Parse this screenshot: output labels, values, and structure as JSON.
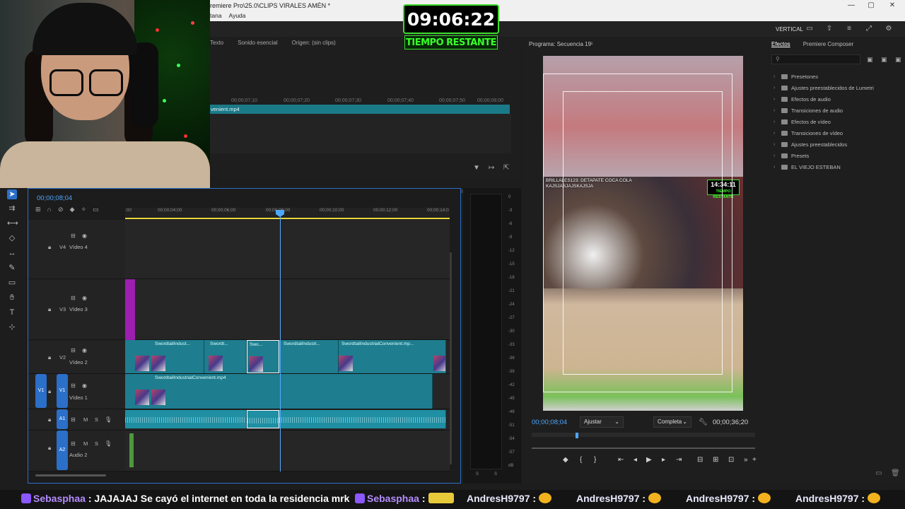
{
  "window": {
    "title": "remiere Pro\\25.0\\CLIPS VIRALES AMÉN *",
    "menu": [
      "tana",
      "Ayuda"
    ],
    "controls": [
      "—",
      "▢",
      "✕"
    ]
  },
  "workspace": {
    "label": "VERTICAL"
  },
  "overlay_timer": {
    "time": "09:06:22",
    "label": "TIEMPO RESTANTE"
  },
  "source_monitor": {
    "tabs": [
      "Texto",
      "Sonido esencial",
      "Origen: (sin clips)"
    ],
    "ruler": [
      "00;00;07;10",
      "00;00;07;20",
      "00;00;07;30",
      "00;00;07;40",
      "00;00;07;50",
      "00;00;08;00"
    ],
    "clip_name": "venient.mp4"
  },
  "program_monitor": {
    "title": "Programa: Secuencia 19",
    "timecode": "00;00;08;04",
    "duration": "00;00;36;20",
    "fit": "Ajustar",
    "quality": "Completa",
    "chat_overlay": "BRILLALES123: DETAPATE COCA COLA\nKAJSJASJAJSKAJSJA",
    "stream_timer": "14:34:11",
    "stream_timer_label": "TIEMPO RESTANTE"
  },
  "effects_panel": {
    "tabs": [
      "Efectos",
      "Premiere Composer"
    ],
    "items": [
      "Presetones",
      "Ajustes preestablecidos de Lumetri",
      "Efectos de audio",
      "Transiciones de audio",
      "Efectos de vídeo",
      "Transiciones de vídeo",
      "Ajustes preestablecidos",
      "Presets",
      "EL VIEJO ESTEBAN"
    ]
  },
  "timeline": {
    "timecode": "00;00;08;04",
    "ruler": [
      ":00",
      "00;00;04;00",
      "00;00;06;00",
      "00;00;08;00",
      "00;00;10;00",
      "00;00;12;00",
      "00;00;14;0"
    ],
    "tracks": {
      "v4": {
        "tag": "V4",
        "name": "Vídeo 4"
      },
      "v3": {
        "tag": "V3",
        "name": "Vídeo 3"
      },
      "v2": {
        "tag": "V2",
        "name": "Vídeo 2"
      },
      "v1": {
        "tag": "V1",
        "src": "V1",
        "name": "Vídeo 1"
      },
      "a1": {
        "tag": "A1",
        "m": "M",
        "s": "S"
      },
      "a2": {
        "tag": "A2",
        "m": "M",
        "s": "S",
        "name": "Audio 2"
      }
    },
    "v2_clips": [
      "SwordtailIndust...",
      "Swordt...",
      "Swo...",
      "SwordtailIndustr...",
      "SwordtailIndustrialConvenient.mp..."
    ],
    "v1_clip": "SwordtailIndustrialConvenient.mp4"
  },
  "meter": {
    "scale": [
      "0",
      "-3",
      "-6",
      "-9",
      "-12",
      "-15",
      "-18",
      "-21",
      "-24",
      "-27",
      "-30",
      "-33",
      "-36",
      "-39",
      "-42",
      "-45",
      "-48",
      "-51",
      "-54",
      "-57",
      "dB"
    ],
    "bottom": [
      "S",
      "S"
    ]
  },
  "chat_ticker": [
    {
      "user": "Sebasphaa",
      "sep": ":",
      "msg": "JAJAJAJ Se cayó el internet en toda la residencia mrk"
    },
    {
      "user": "Sebasphaa",
      "sep": ":",
      "msg": ""
    },
    {
      "user": "AndresH9797",
      "sep": ":",
      "msg": ""
    },
    {
      "user": "AndresH9797",
      "sep": ":",
      "msg": ""
    },
    {
      "user": "AndresH9797",
      "sep": ":",
      "msg": ""
    },
    {
      "user": "AndresH9797",
      "sep": ":",
      "msg": ""
    }
  ]
}
